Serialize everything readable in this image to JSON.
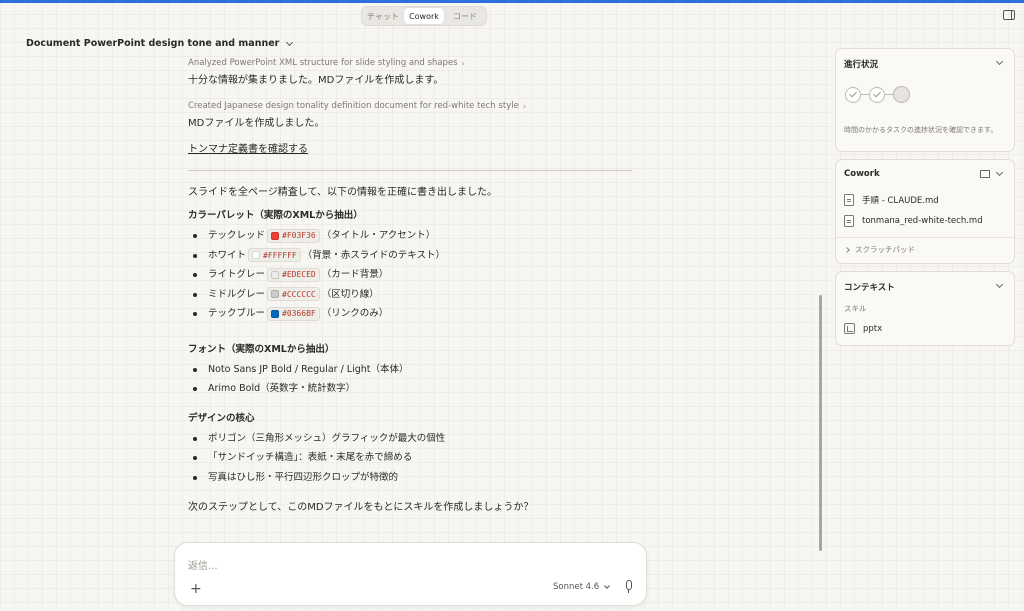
{
  "top_tabs": [
    {
      "label": "チャット",
      "active": false
    },
    {
      "label": "Cowork",
      "active": true
    },
    {
      "label": "コード",
      "active": false
    }
  ],
  "conversation_title": "Document PowerPoint design tone and manner",
  "messages": {
    "step1": "Analyzed PowerPoint XML structure for slide styling and shapes",
    "text1": "十分な情報が集まりました。MDファイルを作成します。",
    "step2": "Created Japanese design tonality definition document for red-white tech style",
    "text2": "MDファイルを作成しました。",
    "link": "トンマナ定義書を確認する",
    "intro": "スライドを全ページ精査して、以下の情報を正確に書き出しました。",
    "palette_heading": "カラーパレット（実際のXMLから抽出）",
    "palette": [
      {
        "name": "テックレッド",
        "hex": "#F03F36",
        "note": "（タイトル・アクセント）"
      },
      {
        "name": "ホワイト",
        "hex": "#FFFFFF",
        "note": "（背景・赤スライドのテキスト）"
      },
      {
        "name": "ライトグレー",
        "hex": "#EDECED",
        "note": "（カード背景）"
      },
      {
        "name": "ミドルグレー",
        "hex": "#CCCCCC",
        "note": "（区切り線）"
      },
      {
        "name": "テックブルー",
        "hex": "#0366BF",
        "note": "（リンクのみ）"
      }
    ],
    "font_heading": "フォント（実際のXMLから抽出）",
    "fonts": [
      "Noto Sans JP Bold / Regular / Light（本体）",
      "Arimo Bold（英数字・統計数字）"
    ],
    "core_heading": "デザインの核心",
    "core": [
      "ポリゴン（三角形メッシュ）グラフィックが最大の個性",
      "「サンドイッチ構造」：表紙・末尾を赤で締める",
      "写真はひし形・平行四辺形クロップが特徴的"
    ],
    "question": "次のステップとして、このMDファイルをもとにスキルを作成しましょうか？"
  },
  "composer": {
    "placeholder": "返信...",
    "model": "Sonnet 4.6"
  },
  "panels": {
    "progress": {
      "title": "進行状況",
      "description": "時間のかかるタスクの進捗状況を確認できます。"
    },
    "cowork": {
      "title": "Cowork",
      "files": [
        "手順 - CLAUDE.md",
        "tonmana_red-white-tech.md"
      ],
      "scratchpad": "スクラッチパッド"
    },
    "context": {
      "title": "コンテキスト",
      "skill_label": "スキル",
      "skill": "pptx"
    }
  },
  "colors": {
    "accent": "#2f6fdc"
  }
}
